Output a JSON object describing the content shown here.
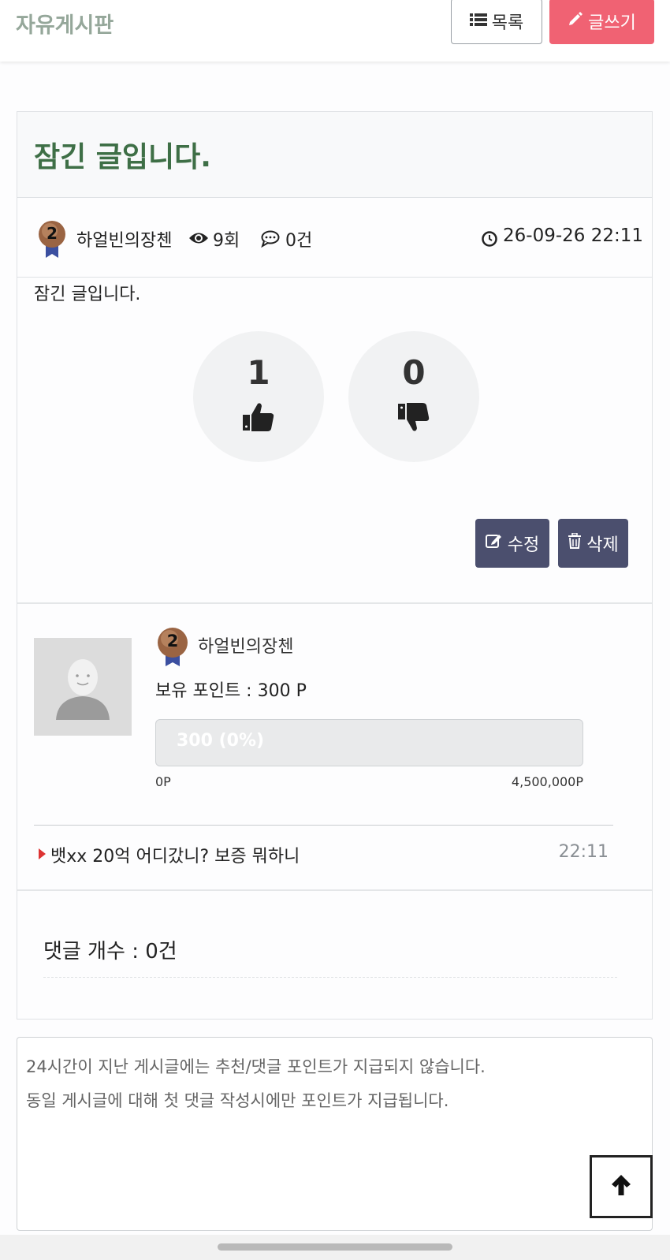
{
  "header": {
    "board_title": "자유게시판",
    "list_button": "목록",
    "write_button": "글쓰기"
  },
  "post": {
    "title": "잠긴 글입니다.",
    "author": "하얼빈의장첸",
    "author_level": "2",
    "views": "9회",
    "comments": "0건",
    "datetime": "26-09-26 22:11",
    "body": "잠긴 글입니다.",
    "likes": "1",
    "dislikes": "0",
    "edit_button": "수정",
    "delete_button": "삭제"
  },
  "profile": {
    "name": "하얼빈의장첸",
    "level": "2",
    "points_text": "보유 포인트 : 300 P",
    "progress_label": "300 (0%)",
    "progress_fraction": 0,
    "scale_min": "0P",
    "scale_max": "4,500,000P"
  },
  "related": {
    "title": "뱃xx 20억 어디갔니? 보증 뭐하니",
    "time": "22:11"
  },
  "comments": {
    "count_text": "댓글 개수 : 0건"
  },
  "notice": {
    "line1": "24시간이 지난 게시글에는 추천/댓글 포인트가 지급되지 않습니다.",
    "line2": "동일 게시글에 대해 첫 댓글 작성시에만 포인트가 지급됩니다."
  },
  "icons": {
    "list": "list-icon",
    "write": "pencil-icon",
    "views": "eye-icon",
    "comments": "comment-icon",
    "time": "clock-icon",
    "like": "thumbs-up-icon",
    "dislike": "thumbs-down-icon",
    "edit": "edit-icon",
    "delete": "trash-icon",
    "scroll_top": "arrow-up-icon"
  },
  "colors": {
    "board_title": "#95a79a",
    "post_title": "#3e6f46",
    "write_button": "#f06273",
    "dark_button": "#4b4f6e",
    "related_arrow": "#dd3333"
  }
}
